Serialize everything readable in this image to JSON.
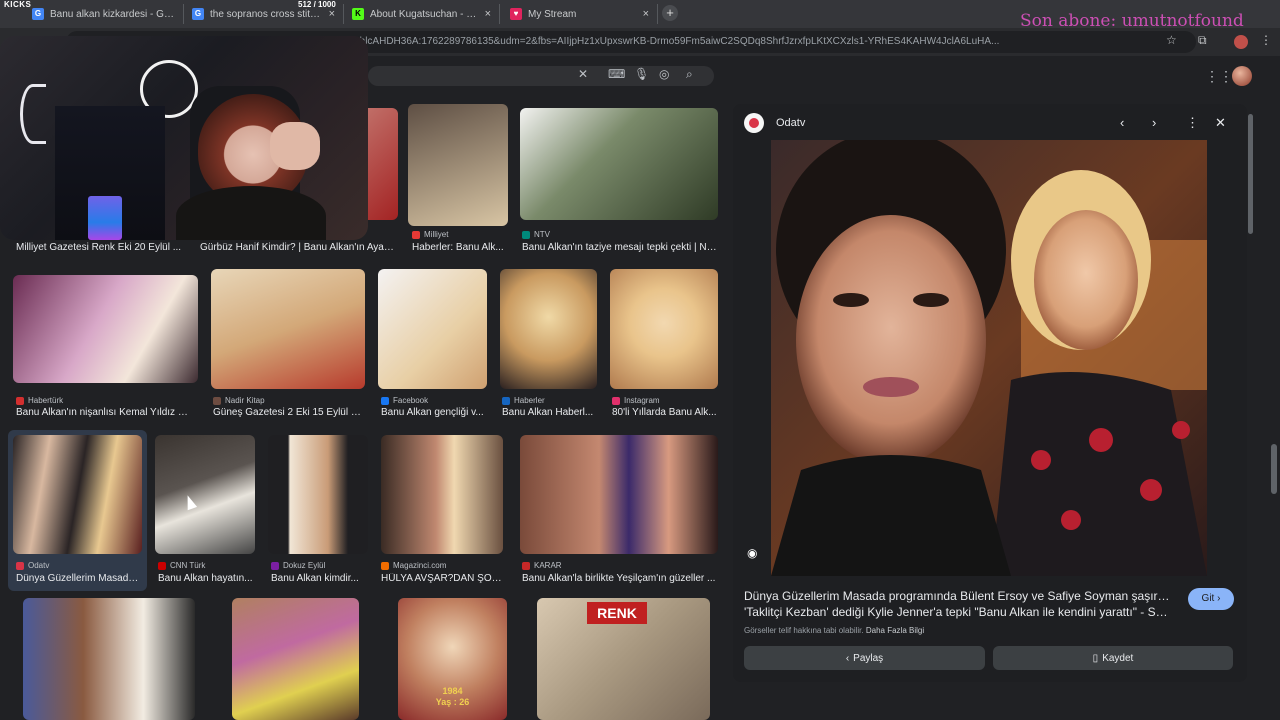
{
  "browser": {
    "tabs": [
      {
        "label": "Banu alkan kizkardesi - Google",
        "favicon": "google-icon",
        "color": "#4285f4"
      },
      {
        "label": "the sopranos cross stitch - Goo",
        "favicon": "google-icon",
        "color": "#4285f4"
      },
      {
        "label": "About Kugatsuchan - Watch Li",
        "favicon": "kick-icon",
        "color": "#53fc18"
      },
      {
        "label": "My Stream",
        "favicon": "stream-icon",
        "color": "#e0245e"
      }
    ],
    "url": "...S6HZN_trTR1132TR1132&sxsrf=AE3TifPXP0-8fgxpc9fFxvg_hlcAHDH36A:1762289786135&udm=2&fbs=AIIjpHz1xUpxswrKB-Drmo59Fm5aiwC2SQDq8ShrfJzrxfpLKtXCXzls1-YRhES4KAHW4JclA6LuHA..."
  },
  "stream": {
    "kicks_label": "KICKS",
    "kicks_counter": "512 / 1000",
    "subscriber_overlay": "Son abone: umutnotfound"
  },
  "results": [
    {
      "source": "",
      "caption": "Milliyet Gazetesi Renk Eki 20 Eylül ...",
      "c1": "#c9a28a",
      "c2": "#3a2e2a"
    },
    {
      "source": "",
      "caption": "Gürbüz Hanif Kimdir? | Banu Alkan'ın Ayakl...",
      "c1": "#e1c0b2",
      "c2": "#a32323"
    },
    {
      "source": "Milliyet",
      "caption": "Haberler: Banu Alk...",
      "c1": "#5e4f44",
      "c2": "#d8c5a4",
      "sf": "#e53935"
    },
    {
      "source": "NTV",
      "caption": "Banu Alkan'ın taziye mesajı tepki çekti | N-...",
      "c1": "#f2f2f0",
      "c2": "#2f3b26",
      "sf": "#00897b"
    },
    {
      "source": "Habertürk",
      "caption": "Banu Alkan'ın nişanlısı Kemal Yıldız ki...",
      "c1": "#6a2c52",
      "c2": "#f3e6da",
      "sf": "#d32f2f"
    },
    {
      "source": "Nadir Kitap",
      "caption": "Güneş Gazetesi 2 Eki 15 Eylül 1...",
      "c1": "#e8d6b8",
      "c2": "#b73a2c",
      "sf": "#6d4c41"
    },
    {
      "source": "Facebook",
      "caption": "Banu Alkan gençliği v...",
      "c1": "#f4f2f2",
      "c2": "#e8cfa5",
      "sf": "#1877f2"
    },
    {
      "source": "Haberler",
      "caption": "Banu Alkan Haberl...",
      "c1": "#f0d9a6",
      "c2": "#2a2020",
      "sf": "#1565c0"
    },
    {
      "source": "Instagram",
      "caption": "80'li Yıllarda Banu Alk...",
      "c1": "#e9c48b",
      "c2": "#b07a4e",
      "sf": "#e1306c"
    },
    {
      "source": "Odatv",
      "caption": "Dünya Güzellerim Masada...",
      "c1": "#2a2425",
      "c2": "#d7a06a",
      "sf": "#d93447"
    },
    {
      "source": "CNN Türk",
      "caption": "Banu Alkan hayatın...",
      "c1": "#5a5450",
      "c2": "#e8e4dc",
      "sf": "#cc0000"
    },
    {
      "source": "Dokuz Eylül",
      "caption": "Banu Alkan kimdir...",
      "c1": "#f1e6d6",
      "c2": "#c99b77",
      "sf": "#7b1fa2"
    },
    {
      "source": "Magazinci.com",
      "caption": "HÜLYA AVŞAR?DAN ŞOK...",
      "c1": "#3a2b24",
      "c2": "#f0d8b0",
      "sf": "#ef6c00"
    },
    {
      "source": "KARAR",
      "caption": "Banu Alkan'la birlikte Yeşilçam'ın güzeller ...",
      "c1": "#7a4a3a",
      "c2": "#3b2a6a",
      "sf": "#c62828"
    },
    {
      "source": "",
      "caption": "",
      "c1": "#4a5a9a",
      "c2": "#f2ece2"
    },
    {
      "source": "",
      "caption": "",
      "c1": "#b08060",
      "c2": "#e0d050"
    },
    {
      "source": "",
      "caption": "",
      "c1": "#8a2a2a",
      "c2": "#f0d6b8"
    },
    {
      "source": "",
      "caption": "",
      "c1": "#d8c8b0",
      "c2": "#7a6a5a"
    }
  ],
  "row3_badge": "1984\nYaş : 26",
  "preview": {
    "source": "Odatv",
    "title_line1": "Dünya Güzellerim Masada programında Bülent Ersoy ve Safiye Soyman şaşırdı...",
    "title_line2": "'Taklitçi Kezban' dediği Kylie Jenner'a tepki \"Banu Alkan ile kendini yarattı\" - Son...",
    "visit_label": "Git",
    "copyright": "Görseller telif hakkına tabi olabilir.",
    "more_info": "Daha Fazla Bilgi",
    "share_label": "Paylaş",
    "save_label": "Kaydet"
  }
}
